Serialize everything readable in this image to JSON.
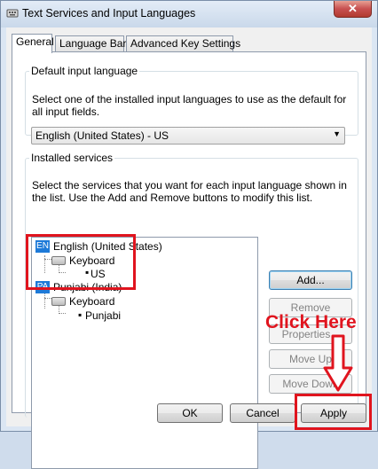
{
  "window": {
    "title": "Text Services and Input Languages",
    "close_glyph": "✕"
  },
  "tabs": [
    {
      "label": "General"
    },
    {
      "label": "Language Bar"
    },
    {
      "label": "Advanced Key Settings"
    }
  ],
  "default_input": {
    "legend": "Default input language",
    "description": "Select one of the installed input languages to use as the default for all input fields.",
    "selected": "English (United States) - US"
  },
  "installed": {
    "legend": "Installed services",
    "description": "Select the services that you want for each input language shown in the list. Use the Add and Remove buttons to modify this list.",
    "languages": [
      {
        "code": "EN",
        "name": "English (United States)",
        "service": "Keyboard",
        "layout": "US"
      },
      {
        "code": "PA",
        "name": "Punjabi (India)",
        "service": "Keyboard",
        "layout": "Punjabi"
      }
    ]
  },
  "side_buttons": {
    "add": "Add...",
    "remove": "Remove",
    "properties": "Properties...",
    "move_up": "Move Up",
    "move_down": "Move Down"
  },
  "footer": {
    "ok": "OK",
    "cancel": "Cancel",
    "apply": "Apply"
  },
  "annotation": {
    "text": "Click Here",
    "color": "#e0141e"
  },
  "colors": {
    "accent": "#1e7ad8",
    "annotation": "#e0141e"
  }
}
